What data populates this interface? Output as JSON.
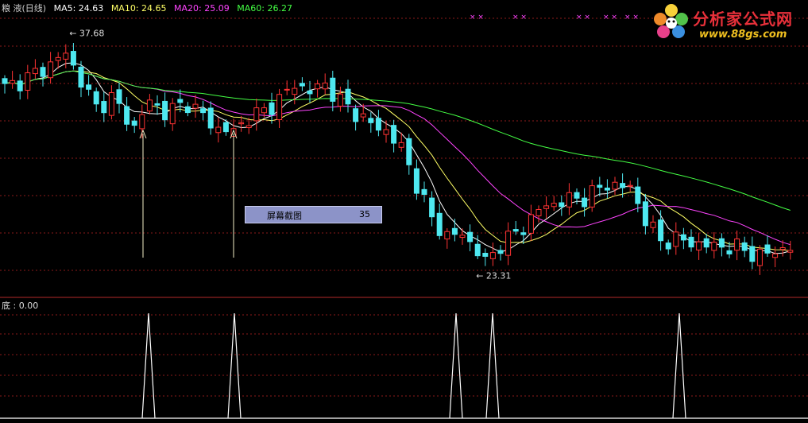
{
  "header": {
    "stock_name": "粮 液(日线)",
    "ma5_label": "MA5: 24.63",
    "ma10_label": "MA10: 24.65",
    "ma20_label": "MA20: 25.09",
    "ma60_label": "MA60: 26.27",
    "colors": {
      "ma5": "#ffffff",
      "ma10": "#ffff66",
      "ma20": "#ff44ff",
      "ma60": "#44ff44",
      "title": "#cccccc"
    }
  },
  "indicator": {
    "label": "底 : 0.00"
  },
  "logo": {
    "title": "分析家公式网",
    "url": "www.88gs.com"
  },
  "popup": {
    "label": "屏幕截图",
    "count": "35"
  },
  "annotations": {
    "high": "37.68",
    "low": "23.31",
    "x_marks": "× ×"
  },
  "chart_data": {
    "type": "candlestick",
    "title": "",
    "xlabel": "",
    "ylabel": "",
    "ylim": [
      22.0,
      39.0
    ],
    "grid": true,
    "high_price": 37.68,
    "low_price": 23.31,
    "ma_values": {
      "MA5": 24.63,
      "MA10": 24.65,
      "MA20": 25.09,
      "MA60": 26.27
    },
    "price_knots": [
      [
        0,
        34.4
      ],
      [
        3,
        35.0
      ],
      [
        6,
        35.8
      ],
      [
        8,
        36.5
      ],
      [
        10,
        34.8
      ],
      [
        12,
        33.2
      ],
      [
        14,
        33.8
      ],
      [
        17,
        32.0
      ],
      [
        19,
        33.6
      ],
      [
        21,
        32.9
      ],
      [
        24,
        33.5
      ],
      [
        26,
        32.7
      ],
      [
        28,
        31.9
      ],
      [
        30,
        31.8
      ],
      [
        32,
        32.6
      ],
      [
        34,
        33.0
      ],
      [
        36,
        33.7
      ],
      [
        38,
        34.6
      ],
      [
        40,
        34.2
      ],
      [
        42,
        34.6
      ],
      [
        44,
        33.6
      ],
      [
        46,
        32.9
      ],
      [
        48,
        32.2
      ],
      [
        50,
        31.8
      ],
      [
        52,
        30.8
      ],
      [
        54,
        28.6
      ],
      [
        56,
        26.5
      ],
      [
        58,
        25.5
      ],
      [
        60,
        25.6
      ],
      [
        62,
        24.6
      ],
      [
        63,
        23.9
      ],
      [
        65,
        25.0
      ],
      [
        68,
        26.0
      ],
      [
        70,
        27.1
      ],
      [
        73,
        27.6
      ],
      [
        76,
        27.8
      ],
      [
        79,
        28.6
      ],
      [
        82,
        28.4
      ],
      [
        84,
        26.5
      ],
      [
        86,
        25.2
      ],
      [
        88,
        25.3
      ],
      [
        91,
        25.0
      ],
      [
        93,
        24.9
      ],
      [
        96,
        24.8
      ],
      [
        99,
        24.3
      ],
      [
        101,
        24.6
      ],
      [
        103,
        24.8
      ]
    ],
    "spikes": [
      {
        "x": 18,
        "value": 1
      },
      {
        "x": 30,
        "value": 1
      },
      {
        "x": 58,
        "value": 1
      },
      {
        "x": 63,
        "value": 1
      },
      {
        "x": 87,
        "value": 1
      }
    ],
    "up_color": "#ff3333",
    "down_color": "#4ee8f0",
    "grid_color": "#8b1a1a",
    "signal_arrow_color": "#f4f0c8",
    "x_mark_color": "#ff44ff"
  }
}
